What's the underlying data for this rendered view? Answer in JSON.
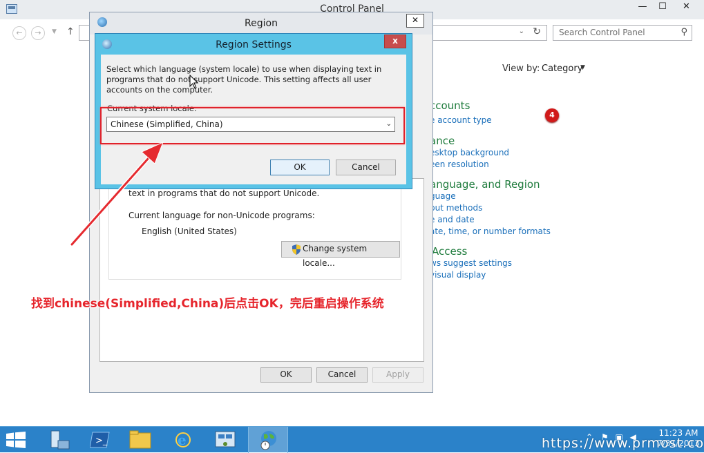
{
  "control_panel": {
    "title": "Control Panel",
    "search_placeholder": "Search Control Panel",
    "view_by_label": "View by:",
    "view_by_value": "Category",
    "categories": [
      {
        "heading": "ccounts",
        "links": [
          "e account type"
        ]
      },
      {
        "heading": "ance",
        "links": [
          "esktop background",
          "een resolution"
        ]
      },
      {
        "heading": "anguage, and Region",
        "links": [
          "guage",
          "put methods",
          "e and date",
          "ate, time, or number formats"
        ]
      },
      {
        "heading": "Access",
        "links": [
          "ws suggest settings",
          "visual display"
        ]
      }
    ],
    "badge": "4"
  },
  "region_dialog": {
    "title": "Region",
    "close": "✕",
    "non_unicode_text": "text in programs that do not support Unicode.",
    "current_language_label": "Current language for non-Unicode programs:",
    "current_language_value": "English (United States)",
    "change_locale_button": "Change system locale...",
    "ok": "OK",
    "cancel": "Cancel",
    "apply": "Apply"
  },
  "region_settings": {
    "title": "Region Settings",
    "close": "x",
    "description": "Select which language (system locale) to use when displaying text in programs that do not support Unicode. This setting affects all user accounts on the computer.",
    "locale_label": "Current system locale:",
    "locale_value": "Chinese (Simplified, China)",
    "ok": "OK",
    "cancel": "Cancel"
  },
  "annotation": "找到chinese(Simplified,China)后点击OK，完后重启操作系统",
  "taskbar": {
    "clock_time": "11:23 AM",
    "clock_date": "7/31/2013",
    "watermark": "https://www.prmost.com"
  },
  "colors": {
    "accent_blue": "#2b82c9",
    "dialog_frame": "#5ac3e6",
    "highlight_red": "#e0222b",
    "link_blue": "#1a6fba",
    "category_green": "#1e7b3c"
  }
}
